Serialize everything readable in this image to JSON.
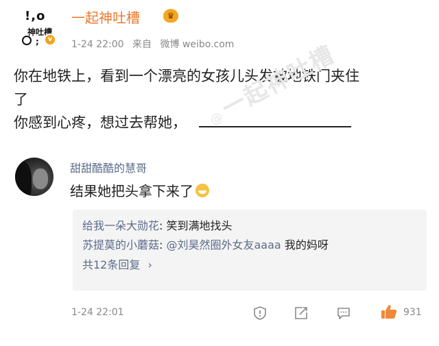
{
  "post": {
    "account": {
      "avatar_text": {
        "line1": "!,o",
        "line2": "神吐槽",
        "line3": ";"
      },
      "verified_mark": "v",
      "name": "一起神吐槽",
      "badge_icon": "crown-badge-icon"
    },
    "time": "1-24 22:00",
    "source_prefix": "来自",
    "source": "微博 weibo.com",
    "lines": [
      "你在地铁上，看到一个漂亮的女孩儿头发被地铁门夹住",
      "了",
      "你感到心疼，想过去帮她，"
    ],
    "watermark": {
      "at": "@",
      "text": "一起神吐槽"
    }
  },
  "comment": {
    "author": "甜甜酷酷的慧哥",
    "text": "结果她把头拿下来了",
    "emoji": "grin-emoji-icon",
    "replies": [
      {
        "author": "给我一朵大勋花",
        "sep": ": ",
        "text": "笑到满地找头"
      },
      {
        "author": "苏提莫的小蘑菇",
        "sep": ": ",
        "text_mention": "@刘昊然圈外女友aaaa",
        "text": " 我的妈呀"
      }
    ],
    "reply_count_label": "共12条回复",
    "reply_count_arrow": "›",
    "time": "1-24 22:01",
    "actions": {
      "report_icon": "shield-report-icon",
      "share_icon": "share-icon",
      "comment_icon": "comment-icon",
      "like_icon": "thumbs-up-icon",
      "like_count": "931"
    }
  },
  "colors": {
    "username": "#ec7a2c",
    "link_blue": "#5b6b8a",
    "meta_gray": "#888888",
    "like_orange": "#f0883a",
    "reply_bg": "#f4f4f4"
  }
}
